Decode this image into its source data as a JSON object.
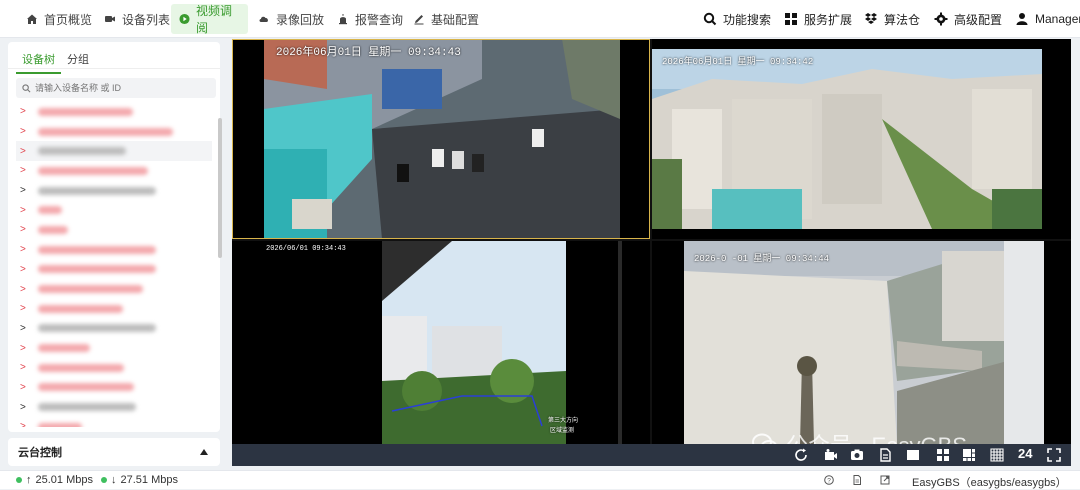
{
  "nav": {
    "items": [
      {
        "label": "首页概览",
        "icon": "home-icon"
      },
      {
        "label": "设备列表",
        "icon": "camera-icon"
      },
      {
        "label": "视频调阅",
        "icon": "play-circle-icon"
      },
      {
        "label": "录像回放",
        "icon": "cloud-icon"
      },
      {
        "label": "报警查询",
        "icon": "alarm-icon"
      },
      {
        "label": "基础配置",
        "icon": "pen-icon"
      }
    ],
    "active_index": 2,
    "right": [
      {
        "label": "功能搜索",
        "icon": "search-icon"
      },
      {
        "label": "服务扩展",
        "icon": "apps-icon"
      },
      {
        "label": "算法仓",
        "icon": "dropbox-icon"
      },
      {
        "label": "高级配置",
        "icon": "gear-icon"
      },
      {
        "label": "Manager",
        "icon": "user-icon"
      }
    ]
  },
  "sidebar": {
    "tabs": [
      "设备树",
      "分组"
    ],
    "active_tab": 0,
    "search_placeholder": "请输入设备名称 或 ID",
    "accent": "#3a9b2f",
    "tree": [
      {
        "expander": "red",
        "label_color": "#f4a9ad",
        "w": 95
      },
      {
        "expander": "red",
        "label_color": "#f4a9ad",
        "w": 135
      },
      {
        "expander": "red",
        "label_color": "#bdbdbd",
        "w": 88
      },
      {
        "expander": "red",
        "label_color": "#f4a9ad",
        "w": 110
      },
      {
        "expander": "dark",
        "label_color": "#bdbdbd",
        "w": 118
      },
      {
        "expander": "red",
        "label_color": "#f4a9ad",
        "w": 24
      },
      {
        "expander": "red",
        "label_color": "#f4a9ad",
        "w": 30
      },
      {
        "expander": "red",
        "label_color": "#f4a9ad",
        "w": 118
      },
      {
        "expander": "red",
        "label_color": "#f4a9ad",
        "w": 118
      },
      {
        "expander": "red",
        "label_color": "#f4a9ad",
        "w": 105
      },
      {
        "expander": "red",
        "label_color": "#f4a9ad",
        "w": 85
      },
      {
        "expander": "dark",
        "label_color": "#bdbdbd",
        "w": 118
      },
      {
        "expander": "red",
        "label_color": "#f4a9ad",
        "w": 52
      },
      {
        "expander": "red",
        "label_color": "#f4a9ad",
        "w": 86
      },
      {
        "expander": "red",
        "label_color": "#f4a9ad",
        "w": 96
      },
      {
        "expander": "dark",
        "label_color": "#bdbdbd",
        "w": 98
      },
      {
        "expander": "red",
        "label_color": "#f4a9ad",
        "w": 44
      }
    ],
    "ptz_label": "云台控制"
  },
  "video": {
    "osd": [
      "2026年06月01日 星期一 09:34:43",
      "2026年06月01日 星期一 09:34:42",
      "2026/06/01 09:34:43",
      "2026-0 -01 星期一 09:34:44"
    ],
    "overlay_text": [
      "第三大方向",
      "区域监测"
    ],
    "layout_count": "24",
    "watermark": "公众号 · EasyGBS"
  },
  "status": {
    "up": "25.01 Mbps",
    "down": "27.51 Mbps",
    "server": "EasyGBS（easygbs/easygbs）",
    "dot_color": "#3fbf5f"
  }
}
